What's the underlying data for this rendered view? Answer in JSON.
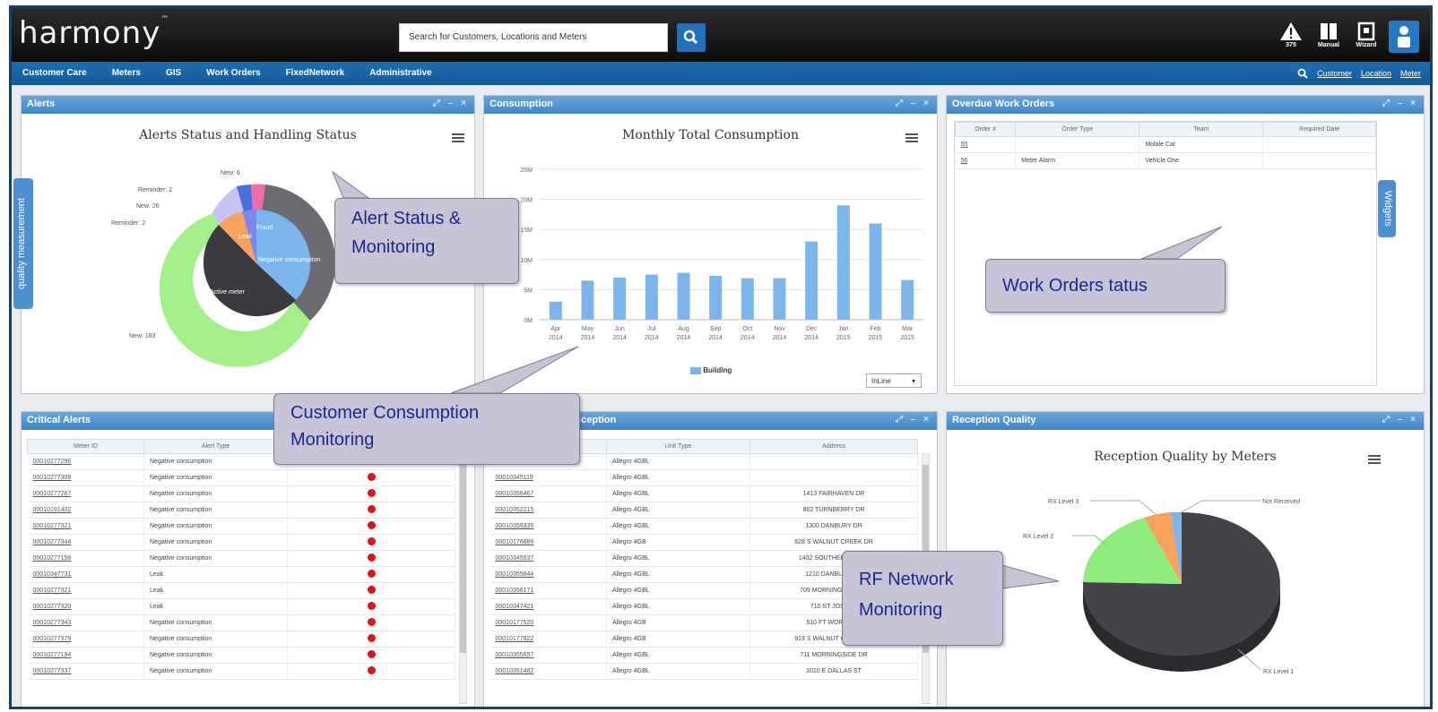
{
  "app": {
    "logo": "harmony",
    "logo_tm": "™"
  },
  "search": {
    "placeholder": "Search for Customers, Locations and Meters"
  },
  "topbar": {
    "alerts_count": "375",
    "manual_label": "Manual",
    "wizard_label": "Wizard"
  },
  "nav": {
    "items": [
      "Customer Care",
      "Meters",
      "GIS",
      "Work Orders",
      "FixedNetwork",
      "Administrative"
    ],
    "right_links": [
      "Customer",
      "Location",
      "Meter"
    ]
  },
  "side_tabs": {
    "left": "quality measurement",
    "right": "Widgets"
  },
  "alerts_panel": {
    "title": "Alerts",
    "chart_title": "Alerts Status and Handling Status",
    "outer_labels": [
      "New: 6",
      "Reminder: 2",
      "New: 26",
      "Reminder: 2",
      "New: 183"
    ],
    "inner_labels": [
      "Negative consumption",
      "Active meter",
      "Leak",
      "Fraud"
    ]
  },
  "consumption_panel": {
    "title": "Consumption",
    "chart_title": "Monthly Total Consumption",
    "legend": "Building",
    "select_value": "InLine"
  },
  "chart_data": {
    "type": "bar",
    "title": "Monthly Total Consumption",
    "categories": [
      "Apr 2014",
      "May 2014",
      "Jun 2014",
      "Jul 2014",
      "Aug 2014",
      "Sep 2014",
      "Oct 2014",
      "Nov 2014",
      "Dec 2014",
      "Jan 2015",
      "Feb 2015",
      "Mar 2015"
    ],
    "series": [
      {
        "name": "Building",
        "values": [
          3,
          6.5,
          7,
          7.5,
          7.8,
          7.3,
          6.9,
          6.9,
          13,
          19,
          16,
          6.6
        ]
      }
    ],
    "yticks": [
      "25M",
      "20M",
      "15M",
      "10M",
      "5M",
      "0M"
    ],
    "ylim": [
      0,
      25
    ],
    "color": "#7cb5ec"
  },
  "work_orders_panel": {
    "title": "Overdue Work Orders",
    "columns": [
      "Order #",
      "Order Type",
      "Team",
      "Required Date"
    ],
    "rows": [
      [
        "55",
        "",
        "Mobile Car",
        ""
      ],
      [
        "56",
        "Meter Alarm",
        "Vehicle One",
        ""
      ]
    ]
  },
  "critical_panel": {
    "title": "Critical Alerts",
    "columns": [
      "Meter ID",
      "Alert Type",
      ""
    ],
    "rows": [
      [
        "00010277296",
        "Negative consumption"
      ],
      [
        "00010277309",
        "Negative consumption"
      ],
      [
        "00010277267",
        "Negative consumption"
      ],
      [
        "00010191402",
        "Negative consumption"
      ],
      [
        "00010277321",
        "Negative consumption"
      ],
      [
        "00010277344",
        "Negative consumption"
      ],
      [
        "00010277158",
        "Negative consumption"
      ],
      [
        "00010347731",
        "Leak"
      ],
      [
        "00010277321",
        "Leak"
      ],
      [
        "00010277320",
        "Leak"
      ],
      [
        "00010277343",
        "Negative consumption"
      ],
      [
        "00010277379",
        "Negative consumption"
      ],
      [
        "00010277194",
        "Negative consumption"
      ],
      [
        "00010277337",
        "Negative consumption"
      ]
    ]
  },
  "reception_table_panel": {
    "title_fragment": "eception",
    "columns": [
      "Meter ID",
      "Unit Type",
      "Address"
    ],
    "rows": [
      [
        "00010345040",
        "Allegro 4GBL",
        ""
      ],
      [
        "00010345119",
        "Allegro 4GBL",
        ""
      ],
      [
        "00010356467",
        "Allegro 4GBL",
        "1413 FAIRHAVEN DR"
      ],
      [
        "00010352215",
        "Allegro 4GBL",
        "802 TURNBERRY DR"
      ],
      [
        "00010359335",
        "Allegro 4GBL",
        "1300 DANBURY DR"
      ],
      [
        "00010176886",
        "Allegro 4GB",
        "828 S WALNUT CREEK DR"
      ],
      [
        "00010345537",
        "Allegro 4GBL",
        "1402 SOUTHERN HILLS"
      ],
      [
        "00010355844",
        "Allegro 4GBL",
        "1210 DANBURY DR"
      ],
      [
        "00010356171",
        "Allegro 4GBL",
        "709 MORNINGSIDE DR"
      ],
      [
        "00010347421",
        "Allegro 4GBL",
        "710 ST JOSEPH"
      ],
      [
        "00010177520",
        "Allegro 4GB",
        "510 FT WORTH ST"
      ],
      [
        "00010177822",
        "Allegro 4GB",
        "919 S WALNUT CREEK DR"
      ],
      [
        "00010355657",
        "Allegro 4GBL",
        "711 MORNINGSIDE DR"
      ],
      [
        "00010351482",
        "Allegro 4GBL",
        "1010 E DALLAS ST"
      ]
    ]
  },
  "reception_quality_panel": {
    "title": "Reception Quality",
    "chart_title": "Reception Quality by Meters",
    "labels": [
      "RX Level 3",
      "Not Received",
      "RX Level 2",
      "RX Level 1"
    ]
  },
  "callouts": {
    "alert": [
      "Alert Status &",
      "Monitoring"
    ],
    "consumption": [
      "Customer Consumption",
      "Monitoring"
    ],
    "work_orders": [
      "Work Orders tatus"
    ],
    "rf": [
      "RF Network",
      "Monitoring"
    ]
  }
}
